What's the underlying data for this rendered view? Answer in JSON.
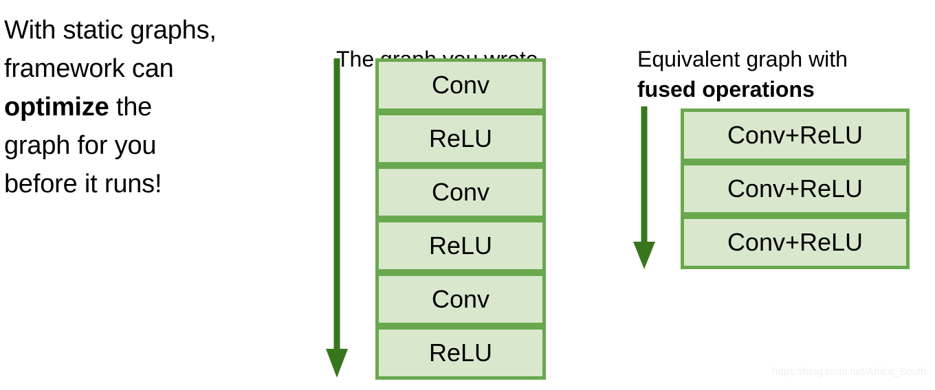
{
  "slide": {
    "background_color": "#ffffff",
    "accent_border_color": "#6aa84f",
    "accent_fill_color": "#d9e8cd",
    "arrow_color": "#38761d",
    "text_color": "#000000"
  },
  "left_text": {
    "line1": "With static graphs,",
    "line2": "framework can",
    "emphasis": "optimize",
    "line3_rest": " the",
    "line4": "graph for you",
    "line5": "before it runs!"
  },
  "columns": [
    {
      "id": "written-graph",
      "header": "The graph you wrote",
      "header_bold_line": "",
      "arrow": {
        "direction": "down",
        "color": "#38761d"
      },
      "nodes": [
        {
          "label": "Conv"
        },
        {
          "label": "ReLU"
        },
        {
          "label": "Conv"
        },
        {
          "label": "ReLU"
        },
        {
          "label": "Conv"
        },
        {
          "label": "ReLU"
        }
      ]
    },
    {
      "id": "fused-graph",
      "header": "Equivalent graph with",
      "header_bold_line": "fused operations",
      "arrow": {
        "direction": "down",
        "color": "#38761d"
      },
      "nodes": [
        {
          "label": "Conv+ReLU"
        },
        {
          "label": "Conv+ReLU"
        },
        {
          "label": "Conv+ReLU"
        }
      ]
    }
  ],
  "watermark": {
    "text": "https://blog.csdn.net/Africa_South"
  }
}
